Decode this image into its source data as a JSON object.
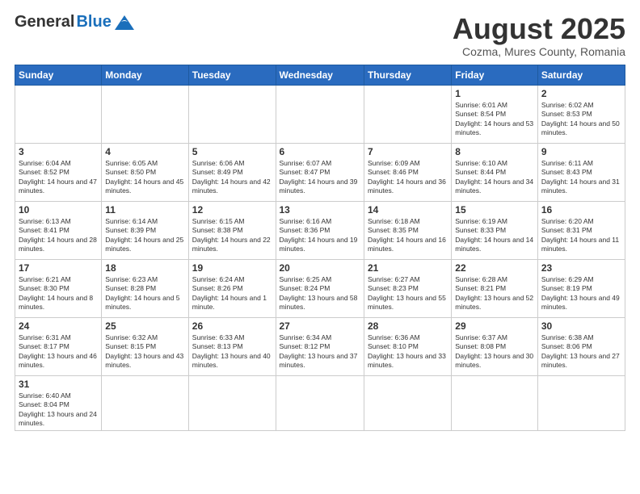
{
  "header": {
    "logo_general": "General",
    "logo_blue": "Blue",
    "month_title": "August 2025",
    "subtitle": "Cozma, Mures County, Romania"
  },
  "days_of_week": [
    "Sunday",
    "Monday",
    "Tuesday",
    "Wednesday",
    "Thursday",
    "Friday",
    "Saturday"
  ],
  "weeks": [
    [
      null,
      null,
      null,
      null,
      null,
      {
        "date": "1",
        "sunrise": "Sunrise: 6:01 AM",
        "sunset": "Sunset: 8:54 PM",
        "daylight": "Daylight: 14 hours and 53 minutes."
      },
      {
        "date": "2",
        "sunrise": "Sunrise: 6:02 AM",
        "sunset": "Sunset: 8:53 PM",
        "daylight": "Daylight: 14 hours and 50 minutes."
      }
    ],
    [
      {
        "date": "3",
        "sunrise": "Sunrise: 6:04 AM",
        "sunset": "Sunset: 8:52 PM",
        "daylight": "Daylight: 14 hours and 47 minutes."
      },
      {
        "date": "4",
        "sunrise": "Sunrise: 6:05 AM",
        "sunset": "Sunset: 8:50 PM",
        "daylight": "Daylight: 14 hours and 45 minutes."
      },
      {
        "date": "5",
        "sunrise": "Sunrise: 6:06 AM",
        "sunset": "Sunset: 8:49 PM",
        "daylight": "Daylight: 14 hours and 42 minutes."
      },
      {
        "date": "6",
        "sunrise": "Sunrise: 6:07 AM",
        "sunset": "Sunset: 8:47 PM",
        "daylight": "Daylight: 14 hours and 39 minutes."
      },
      {
        "date": "7",
        "sunrise": "Sunrise: 6:09 AM",
        "sunset": "Sunset: 8:46 PM",
        "daylight": "Daylight: 14 hours and 36 minutes."
      },
      {
        "date": "8",
        "sunrise": "Sunrise: 6:10 AM",
        "sunset": "Sunset: 8:44 PM",
        "daylight": "Daylight: 14 hours and 34 minutes."
      },
      {
        "date": "9",
        "sunrise": "Sunrise: 6:11 AM",
        "sunset": "Sunset: 8:43 PM",
        "daylight": "Daylight: 14 hours and 31 minutes."
      }
    ],
    [
      {
        "date": "10",
        "sunrise": "Sunrise: 6:13 AM",
        "sunset": "Sunset: 8:41 PM",
        "daylight": "Daylight: 14 hours and 28 minutes."
      },
      {
        "date": "11",
        "sunrise": "Sunrise: 6:14 AM",
        "sunset": "Sunset: 8:39 PM",
        "daylight": "Daylight: 14 hours and 25 minutes."
      },
      {
        "date": "12",
        "sunrise": "Sunrise: 6:15 AM",
        "sunset": "Sunset: 8:38 PM",
        "daylight": "Daylight: 14 hours and 22 minutes."
      },
      {
        "date": "13",
        "sunrise": "Sunrise: 6:16 AM",
        "sunset": "Sunset: 8:36 PM",
        "daylight": "Daylight: 14 hours and 19 minutes."
      },
      {
        "date": "14",
        "sunrise": "Sunrise: 6:18 AM",
        "sunset": "Sunset: 8:35 PM",
        "daylight": "Daylight: 14 hours and 16 minutes."
      },
      {
        "date": "15",
        "sunrise": "Sunrise: 6:19 AM",
        "sunset": "Sunset: 8:33 PM",
        "daylight": "Daylight: 14 hours and 14 minutes."
      },
      {
        "date": "16",
        "sunrise": "Sunrise: 6:20 AM",
        "sunset": "Sunset: 8:31 PM",
        "daylight": "Daylight: 14 hours and 11 minutes."
      }
    ],
    [
      {
        "date": "17",
        "sunrise": "Sunrise: 6:21 AM",
        "sunset": "Sunset: 8:30 PM",
        "daylight": "Daylight: 14 hours and 8 minutes."
      },
      {
        "date": "18",
        "sunrise": "Sunrise: 6:23 AM",
        "sunset": "Sunset: 8:28 PM",
        "daylight": "Daylight: 14 hours and 5 minutes."
      },
      {
        "date": "19",
        "sunrise": "Sunrise: 6:24 AM",
        "sunset": "Sunset: 8:26 PM",
        "daylight": "Daylight: 14 hours and 1 minute."
      },
      {
        "date": "20",
        "sunrise": "Sunrise: 6:25 AM",
        "sunset": "Sunset: 8:24 PM",
        "daylight": "Daylight: 13 hours and 58 minutes."
      },
      {
        "date": "21",
        "sunrise": "Sunrise: 6:27 AM",
        "sunset": "Sunset: 8:23 PM",
        "daylight": "Daylight: 13 hours and 55 minutes."
      },
      {
        "date": "22",
        "sunrise": "Sunrise: 6:28 AM",
        "sunset": "Sunset: 8:21 PM",
        "daylight": "Daylight: 13 hours and 52 minutes."
      },
      {
        "date": "23",
        "sunrise": "Sunrise: 6:29 AM",
        "sunset": "Sunset: 8:19 PM",
        "daylight": "Daylight: 13 hours and 49 minutes."
      }
    ],
    [
      {
        "date": "24",
        "sunrise": "Sunrise: 6:31 AM",
        "sunset": "Sunset: 8:17 PM",
        "daylight": "Daylight: 13 hours and 46 minutes."
      },
      {
        "date": "25",
        "sunrise": "Sunrise: 6:32 AM",
        "sunset": "Sunset: 8:15 PM",
        "daylight": "Daylight: 13 hours and 43 minutes."
      },
      {
        "date": "26",
        "sunrise": "Sunrise: 6:33 AM",
        "sunset": "Sunset: 8:13 PM",
        "daylight": "Daylight: 13 hours and 40 minutes."
      },
      {
        "date": "27",
        "sunrise": "Sunrise: 6:34 AM",
        "sunset": "Sunset: 8:12 PM",
        "daylight": "Daylight: 13 hours and 37 minutes."
      },
      {
        "date": "28",
        "sunrise": "Sunrise: 6:36 AM",
        "sunset": "Sunset: 8:10 PM",
        "daylight": "Daylight: 13 hours and 33 minutes."
      },
      {
        "date": "29",
        "sunrise": "Sunrise: 6:37 AM",
        "sunset": "Sunset: 8:08 PM",
        "daylight": "Daylight: 13 hours and 30 minutes."
      },
      {
        "date": "30",
        "sunrise": "Sunrise: 6:38 AM",
        "sunset": "Sunset: 8:06 PM",
        "daylight": "Daylight: 13 hours and 27 minutes."
      }
    ],
    [
      {
        "date": "31",
        "sunrise": "Sunrise: 6:40 AM",
        "sunset": "Sunset: 8:04 PM",
        "daylight": "Daylight: 13 hours and 24 minutes."
      },
      null,
      null,
      null,
      null,
      null,
      null
    ]
  ]
}
